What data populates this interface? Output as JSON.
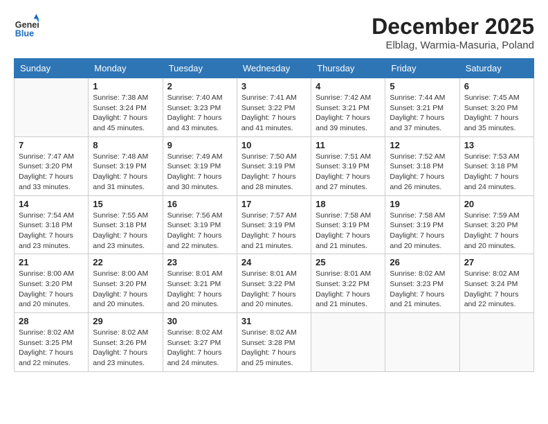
{
  "header": {
    "logo_general": "General",
    "logo_blue": "Blue",
    "month_year": "December 2025",
    "location": "Elblag, Warmia-Masuria, Poland"
  },
  "weekdays": [
    "Sunday",
    "Monday",
    "Tuesday",
    "Wednesday",
    "Thursday",
    "Friday",
    "Saturday"
  ],
  "weeks": [
    [
      {
        "day": "",
        "sunrise": "",
        "sunset": "",
        "daylight": ""
      },
      {
        "day": "1",
        "sunrise": "Sunrise: 7:38 AM",
        "sunset": "Sunset: 3:24 PM",
        "daylight": "Daylight: 7 hours and 45 minutes."
      },
      {
        "day": "2",
        "sunrise": "Sunrise: 7:40 AM",
        "sunset": "Sunset: 3:23 PM",
        "daylight": "Daylight: 7 hours and 43 minutes."
      },
      {
        "day": "3",
        "sunrise": "Sunrise: 7:41 AM",
        "sunset": "Sunset: 3:22 PM",
        "daylight": "Daylight: 7 hours and 41 minutes."
      },
      {
        "day": "4",
        "sunrise": "Sunrise: 7:42 AM",
        "sunset": "Sunset: 3:21 PM",
        "daylight": "Daylight: 7 hours and 39 minutes."
      },
      {
        "day": "5",
        "sunrise": "Sunrise: 7:44 AM",
        "sunset": "Sunset: 3:21 PM",
        "daylight": "Daylight: 7 hours and 37 minutes."
      },
      {
        "day": "6",
        "sunrise": "Sunrise: 7:45 AM",
        "sunset": "Sunset: 3:20 PM",
        "daylight": "Daylight: 7 hours and 35 minutes."
      }
    ],
    [
      {
        "day": "7",
        "sunrise": "Sunrise: 7:47 AM",
        "sunset": "Sunset: 3:20 PM",
        "daylight": "Daylight: 7 hours and 33 minutes."
      },
      {
        "day": "8",
        "sunrise": "Sunrise: 7:48 AM",
        "sunset": "Sunset: 3:19 PM",
        "daylight": "Daylight: 7 hours and 31 minutes."
      },
      {
        "day": "9",
        "sunrise": "Sunrise: 7:49 AM",
        "sunset": "Sunset: 3:19 PM",
        "daylight": "Daylight: 7 hours and 30 minutes."
      },
      {
        "day": "10",
        "sunrise": "Sunrise: 7:50 AM",
        "sunset": "Sunset: 3:19 PM",
        "daylight": "Daylight: 7 hours and 28 minutes."
      },
      {
        "day": "11",
        "sunrise": "Sunrise: 7:51 AM",
        "sunset": "Sunset: 3:19 PM",
        "daylight": "Daylight: 7 hours and 27 minutes."
      },
      {
        "day": "12",
        "sunrise": "Sunrise: 7:52 AM",
        "sunset": "Sunset: 3:18 PM",
        "daylight": "Daylight: 7 hours and 26 minutes."
      },
      {
        "day": "13",
        "sunrise": "Sunrise: 7:53 AM",
        "sunset": "Sunset: 3:18 PM",
        "daylight": "Daylight: 7 hours and 24 minutes."
      }
    ],
    [
      {
        "day": "14",
        "sunrise": "Sunrise: 7:54 AM",
        "sunset": "Sunset: 3:18 PM",
        "daylight": "Daylight: 7 hours and 23 minutes."
      },
      {
        "day": "15",
        "sunrise": "Sunrise: 7:55 AM",
        "sunset": "Sunset: 3:18 PM",
        "daylight": "Daylight: 7 hours and 23 minutes."
      },
      {
        "day": "16",
        "sunrise": "Sunrise: 7:56 AM",
        "sunset": "Sunset: 3:19 PM",
        "daylight": "Daylight: 7 hours and 22 minutes."
      },
      {
        "day": "17",
        "sunrise": "Sunrise: 7:57 AM",
        "sunset": "Sunset: 3:19 PM",
        "daylight": "Daylight: 7 hours and 21 minutes."
      },
      {
        "day": "18",
        "sunrise": "Sunrise: 7:58 AM",
        "sunset": "Sunset: 3:19 PM",
        "daylight": "Daylight: 7 hours and 21 minutes."
      },
      {
        "day": "19",
        "sunrise": "Sunrise: 7:58 AM",
        "sunset": "Sunset: 3:19 PM",
        "daylight": "Daylight: 7 hours and 20 minutes."
      },
      {
        "day": "20",
        "sunrise": "Sunrise: 7:59 AM",
        "sunset": "Sunset: 3:20 PM",
        "daylight": "Daylight: 7 hours and 20 minutes."
      }
    ],
    [
      {
        "day": "21",
        "sunrise": "Sunrise: 8:00 AM",
        "sunset": "Sunset: 3:20 PM",
        "daylight": "Daylight: 7 hours and 20 minutes."
      },
      {
        "day": "22",
        "sunrise": "Sunrise: 8:00 AM",
        "sunset": "Sunset: 3:20 PM",
        "daylight": "Daylight: 7 hours and 20 minutes."
      },
      {
        "day": "23",
        "sunrise": "Sunrise: 8:01 AM",
        "sunset": "Sunset: 3:21 PM",
        "daylight": "Daylight: 7 hours and 20 minutes."
      },
      {
        "day": "24",
        "sunrise": "Sunrise: 8:01 AM",
        "sunset": "Sunset: 3:22 PM",
        "daylight": "Daylight: 7 hours and 20 minutes."
      },
      {
        "day": "25",
        "sunrise": "Sunrise: 8:01 AM",
        "sunset": "Sunset: 3:22 PM",
        "daylight": "Daylight: 7 hours and 21 minutes."
      },
      {
        "day": "26",
        "sunrise": "Sunrise: 8:02 AM",
        "sunset": "Sunset: 3:23 PM",
        "daylight": "Daylight: 7 hours and 21 minutes."
      },
      {
        "day": "27",
        "sunrise": "Sunrise: 8:02 AM",
        "sunset": "Sunset: 3:24 PM",
        "daylight": "Daylight: 7 hours and 22 minutes."
      }
    ],
    [
      {
        "day": "28",
        "sunrise": "Sunrise: 8:02 AM",
        "sunset": "Sunset: 3:25 PM",
        "daylight": "Daylight: 7 hours and 22 minutes."
      },
      {
        "day": "29",
        "sunrise": "Sunrise: 8:02 AM",
        "sunset": "Sunset: 3:26 PM",
        "daylight": "Daylight: 7 hours and 23 minutes."
      },
      {
        "day": "30",
        "sunrise": "Sunrise: 8:02 AM",
        "sunset": "Sunset: 3:27 PM",
        "daylight": "Daylight: 7 hours and 24 minutes."
      },
      {
        "day": "31",
        "sunrise": "Sunrise: 8:02 AM",
        "sunset": "Sunset: 3:28 PM",
        "daylight": "Daylight: 7 hours and 25 minutes."
      },
      {
        "day": "",
        "sunrise": "",
        "sunset": "",
        "daylight": ""
      },
      {
        "day": "",
        "sunrise": "",
        "sunset": "",
        "daylight": ""
      },
      {
        "day": "",
        "sunrise": "",
        "sunset": "",
        "daylight": ""
      }
    ]
  ]
}
